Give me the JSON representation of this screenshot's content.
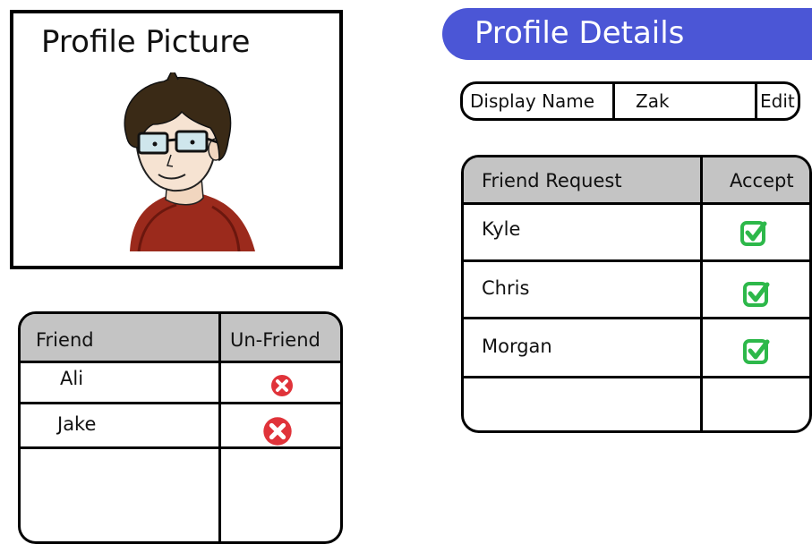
{
  "profile_picture": {
    "title": "Profile Picture",
    "avatar_icon": "cartoon-avatar-icon"
  },
  "profile_details": {
    "title": "Profile Details",
    "banner_color": "#4b56d6",
    "display_name_label": "Display Name",
    "display_name_value": "Zak",
    "edit_label": "Edit"
  },
  "friend_requests": {
    "headers": {
      "name": "Friend Request",
      "action": "Accept"
    },
    "header_bg": "#c4c4c4",
    "accept_icon": "green-check-icon",
    "accept_color": "#2db84a",
    "rows": [
      {
        "name": "Kyle"
      },
      {
        "name": "Chris"
      },
      {
        "name": "Morgan"
      }
    ]
  },
  "friends": {
    "headers": {
      "name": "Friend",
      "action": "Un-Friend"
    },
    "header_bg": "#c4c4c4",
    "unfriend_icon": "red-x-icon",
    "unfriend_color": "#e0333a",
    "rows": [
      {
        "name": "Ali"
      },
      {
        "name": "Jake"
      }
    ]
  }
}
